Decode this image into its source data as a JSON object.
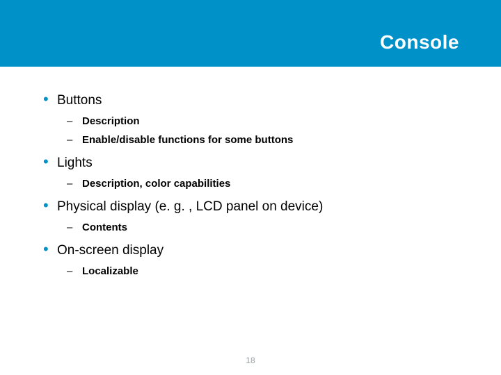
{
  "header": {
    "title": "Console"
  },
  "bullets": [
    {
      "text": "Buttons",
      "subs": [
        {
          "text": "Description"
        },
        {
          "text": "Enable/disable functions for some buttons"
        }
      ]
    },
    {
      "text": "Lights",
      "subs": [
        {
          "text": "Description, color capabilities"
        }
      ]
    },
    {
      "text": "Physical display (e. g. , LCD panel on device)",
      "subs": [
        {
          "text": "Contents"
        }
      ]
    },
    {
      "text": "On-screen display",
      "subs": [
        {
          "text": "Localizable"
        }
      ]
    }
  ],
  "pageNumber": "18"
}
